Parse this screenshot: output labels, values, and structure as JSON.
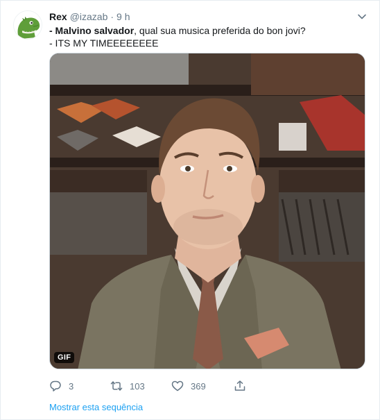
{
  "tweet": {
    "name": "Rex",
    "handle": "@izazab",
    "separator": "·",
    "time": "9 h",
    "text_line1_bold": "- Malvino salvador",
    "text_line1_rest": ", qual sua musica preferida do bon jovi?",
    "text_line2": "- ITS MY TIMEEEEEEEE",
    "media_badge": "GIF",
    "reply_count": "3",
    "retweet_count": "103",
    "like_count": "369",
    "thread_link": "Mostrar esta sequência"
  },
  "icons": {
    "avatar": "green-dinosaur-avatar",
    "caret": "chevron-down-icon",
    "reply": "speech-bubble-icon",
    "retweet": "retweet-arrows-icon",
    "like": "heart-icon",
    "share": "share-upload-icon"
  },
  "colors": {
    "text": "#14171a",
    "muted": "#657786",
    "link": "#1da1f2",
    "border": "#e6ecf0"
  }
}
